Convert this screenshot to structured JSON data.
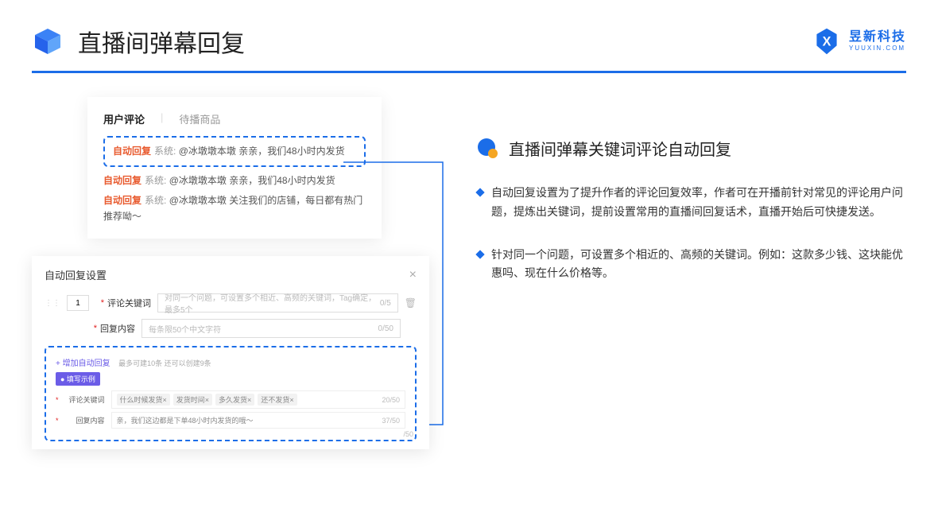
{
  "header": {
    "title": "直播间弹幕回复"
  },
  "brand": {
    "name": "昱新科技",
    "url": "YUUXIN.COM"
  },
  "card1": {
    "tabs": {
      "active": "用户评论",
      "inactive": "待播商品"
    },
    "c1_label": "自动回复",
    "c1_sys": "系统:",
    "c1_text": "@冰墩墩本墩 亲亲，我们48小时内发货",
    "c2_label": "自动回复",
    "c2_sys": "系统:",
    "c2_text": "@冰墩墩本墩 亲亲，我们48小时内发货",
    "c3_label": "自动回复",
    "c3_sys": "系统:",
    "c3_text": "@冰墩墩本墩 关注我们的店铺，每日都有热门推荐呦～"
  },
  "card2": {
    "title": "自动回复设置",
    "num": "1",
    "kw_label": "评论关键词",
    "kw_placeholder": "对同一个问题，可设置多个相近、高频的关键词，Tag确定，最多5个",
    "kw_count": "0/5",
    "reply_label": "回复内容",
    "reply_placeholder": "每条限50个中文字符",
    "reply_count": "0/50",
    "add_link": "+ 增加自动回复",
    "add_hint": "最多可建10条 还可以创建9条",
    "badge": "● 填写示例",
    "ex_kw_label": "评论关键词",
    "tags": {
      "t1": "什么时候发货×",
      "t2": "发货时间×",
      "t3": "多久发货×",
      "t4": "还不发货×"
    },
    "ex_kw_count": "20/50",
    "ex_reply_label": "回复内容",
    "ex_reply_text": "亲，我们这边都是下单48小时内发货的哦～",
    "ex_reply_count": "37/50",
    "out_count": "/50"
  },
  "section": {
    "title": "直播间弹幕关键词评论自动回复",
    "b1": "自动回复设置为了提升作者的评论回复效率，作者可在开播前针对常见的评论用户问题，提炼出关键词，提前设置常用的直播间回复话术，直播开始后可快捷发送。",
    "b2": "针对同一个问题，可设置多个相近的、高频的关键词。例如：这款多少钱、这块能优惠吗、现在什么价格等。"
  }
}
